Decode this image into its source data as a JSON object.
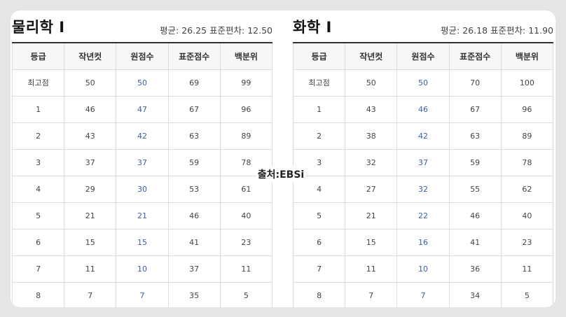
{
  "source_label": "출처:EBSi",
  "columns": [
    "등급",
    "작년컷",
    "원점수",
    "표준점수",
    "백분위"
  ],
  "tables": [
    {
      "subject": "물리학 Ⅰ",
      "mean_text": "평균: 26.25",
      "sd_text": "표준편차: 12.50",
      "rows": [
        [
          "최고점",
          "50",
          "50",
          "69",
          "99"
        ],
        [
          "1",
          "46",
          "47",
          "67",
          "96"
        ],
        [
          "2",
          "43",
          "42",
          "63",
          "89"
        ],
        [
          "3",
          "37",
          "37",
          "59",
          "78"
        ],
        [
          "4",
          "29",
          "30",
          "53",
          "61"
        ],
        [
          "5",
          "21",
          "21",
          "46",
          "40"
        ],
        [
          "6",
          "15",
          "15",
          "41",
          "23"
        ],
        [
          "7",
          "11",
          "10",
          "37",
          "11"
        ],
        [
          "8",
          "7",
          "7",
          "35",
          "5"
        ]
      ]
    },
    {
      "subject": "화학 Ⅰ",
      "mean_text": "평균: 26.18",
      "sd_text": "표준편차: 11.90",
      "rows": [
        [
          "최고점",
          "50",
          "50",
          "70",
          "100"
        ],
        [
          "1",
          "43",
          "46",
          "67",
          "96"
        ],
        [
          "2",
          "38",
          "42",
          "63",
          "89"
        ],
        [
          "3",
          "32",
          "37",
          "59",
          "78"
        ],
        [
          "4",
          "27",
          "32",
          "55",
          "62"
        ],
        [
          "5",
          "21",
          "22",
          "46",
          "40"
        ],
        [
          "6",
          "15",
          "16",
          "41",
          "23"
        ],
        [
          "7",
          "11",
          "10",
          "36",
          "11"
        ],
        [
          "8",
          "7",
          "7",
          "34",
          "5"
        ]
      ]
    }
  ]
}
